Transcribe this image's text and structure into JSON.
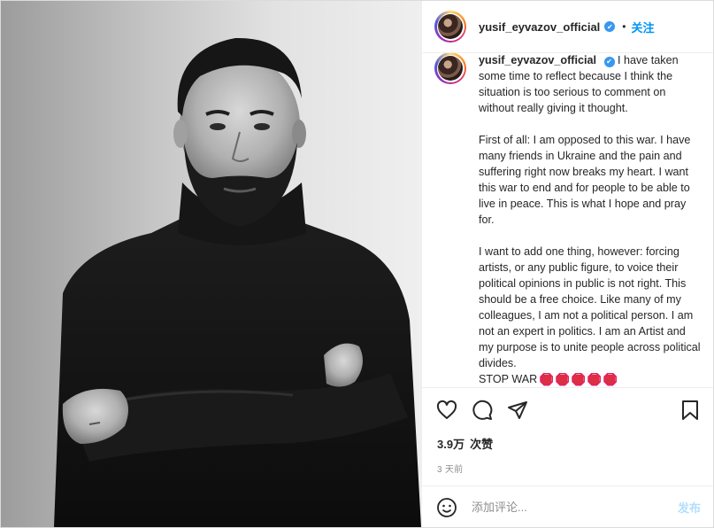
{
  "post": {
    "username": "yusif_eyvazov_official",
    "verified_mark": "✔",
    "dot": "•",
    "follow_label": "关注",
    "caption": {
      "username": "yusif_eyvazov_official",
      "paragraphs": [
        "I have taken some time to reflect because I think the situation is too serious to comment on without really giving it thought.",
        "First of all: I am opposed to this war. I have many friends in Ukraine and the pain and suffering right now breaks my heart. I want this war to end and for people to be able to live in peace. This is what I hope and pray for.",
        "I want to add one thing, however: forcing artists, or any public figure, to voice their political opinions in public is not right. This should be a free choice. Like many of my colleagues, I am not a political person. I am not an expert in politics. I am an Artist and my purpose is to unite people across political divides."
      ],
      "closing": "STOP WAR",
      "stop_sign_icon": "stop-sign-emoji",
      "stop_sign_count": 5
    },
    "actions": {
      "like_icon": "heart-icon",
      "comment_icon": "comment-bubble-icon",
      "share_icon": "paper-plane-icon",
      "save_icon": "bookmark-icon"
    },
    "likes": {
      "count": "3.9万",
      "label": "次赞"
    },
    "time": "3 天前",
    "comment_input": {
      "placeholder": "添加评论...",
      "emoji_icon": "smiley-icon"
    },
    "post_label": "发布",
    "photo": {
      "description_icon": "portrait-photo",
      "tone": "black-and-white"
    }
  }
}
